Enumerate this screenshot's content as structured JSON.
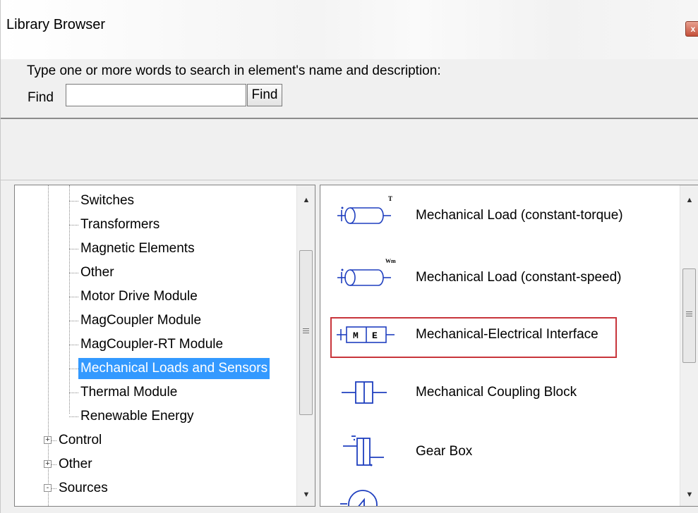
{
  "window": {
    "title": "Library Browser",
    "close_glyph": "x"
  },
  "search": {
    "prompt": "Type one or more words to search in element's name and  description:",
    "find_label": "Find",
    "input_value": "",
    "button_label": "Find"
  },
  "tree": {
    "items": [
      {
        "label": "Switches",
        "selected": false
      },
      {
        "label": "Transformers",
        "selected": false
      },
      {
        "label": "Magnetic Elements",
        "selected": false
      },
      {
        "label": "Other",
        "selected": false
      },
      {
        "label": "Motor Drive Module",
        "selected": false
      },
      {
        "label": "MagCoupler Module",
        "selected": false
      },
      {
        "label": "MagCoupler-RT Module",
        "selected": false
      },
      {
        "label": "Mechanical Loads and Sensors",
        "selected": true
      },
      {
        "label": "Thermal Module",
        "selected": false
      },
      {
        "label": "Renewable Energy",
        "selected": false
      }
    ],
    "groups": [
      {
        "label": "Control",
        "expander": "+"
      },
      {
        "label": "Other",
        "expander": "+"
      },
      {
        "label": "Sources",
        "expander": "-"
      }
    ]
  },
  "elements": [
    {
      "label": "Mechanical Load (constant-torque)",
      "icon": "mechanical-load-torque-icon",
      "symbol": "T"
    },
    {
      "label": "Mechanical Load (constant-speed)",
      "icon": "mechanical-load-speed-icon",
      "symbol": "Wm"
    },
    {
      "label": "Mechanical-Electrical Interface",
      "icon": "mechanical-electrical-interface-icon",
      "symbol_left": "M",
      "symbol_right": "E",
      "highlighted": true
    },
    {
      "label": "Mechanical Coupling Block",
      "icon": "mechanical-coupling-block-icon"
    },
    {
      "label": "Gear Box",
      "icon": "gear-box-icon"
    }
  ],
  "scroll": {
    "arrow_up": "▲",
    "arrow_down": "▼"
  },
  "colors": {
    "selection": "#3399ff",
    "highlight_border": "#c8353b",
    "icon_blue": "#1f3fbf"
  }
}
